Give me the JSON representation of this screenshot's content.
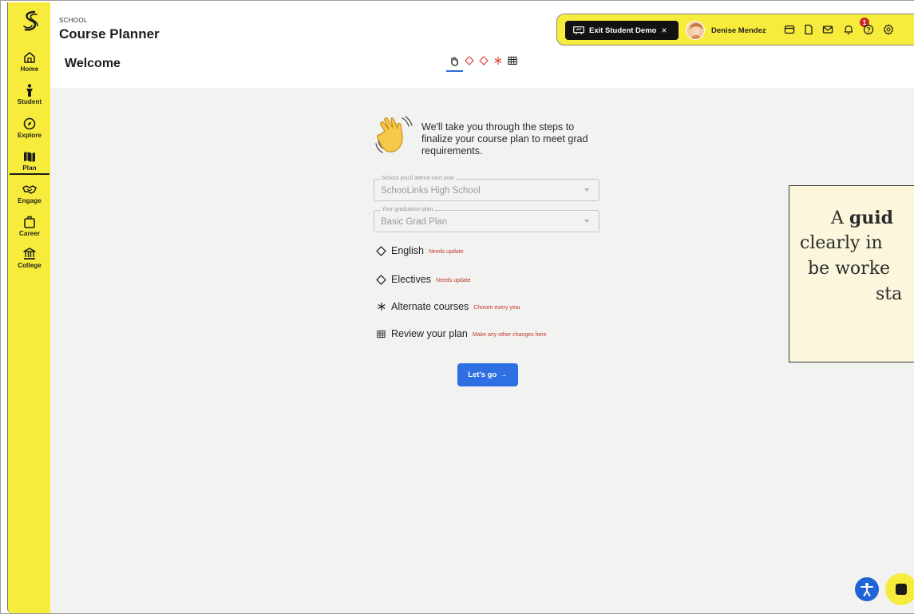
{
  "app": {
    "school_caption": "SCHOOL",
    "title": "Course Planner"
  },
  "page": {
    "title": "Welcome"
  },
  "sidebar": {
    "items": [
      {
        "label": "Home",
        "icon": "home-icon"
      },
      {
        "label": "Student",
        "icon": "student-icon"
      },
      {
        "label": "Explore",
        "icon": "compass-icon"
      },
      {
        "label": "Plan",
        "icon": "map-icon",
        "active": true
      },
      {
        "label": "Engage",
        "icon": "handshake-icon"
      },
      {
        "label": "Career",
        "icon": "briefcase-icon"
      },
      {
        "label": "College",
        "icon": "college-icon"
      }
    ]
  },
  "toolbar": {
    "exit_demo_label": "Exit Student Demo",
    "exit_demo_close": "×",
    "user_name": "Denise Mendez",
    "notification_count": "1",
    "icons": [
      "wallet-icon",
      "document-icon",
      "mail-icon",
      "bell-icon",
      "help-icon",
      "settings-icon"
    ]
  },
  "step_tabs": [
    "wave-icon",
    "diamond-icon",
    "diamond-icon",
    "asterisk-icon",
    "grid-icon"
  ],
  "intro": {
    "text": "We'll take you through the steps to finalize your course plan to meet grad requirements."
  },
  "form": {
    "school_legend": "School you'll attend next year",
    "school_value": "SchooLinks High School",
    "plan_legend": "Your graduation plan",
    "plan_value": "Basic Grad Plan"
  },
  "steps": [
    {
      "icon": "diamond-icon",
      "label": "English",
      "note": "Needs update"
    },
    {
      "icon": "diamond-icon",
      "label": "Electives",
      "note": "Needs update"
    },
    {
      "icon": "asterisk-icon",
      "label": "Alternate courses",
      "note": "Chosen every year"
    },
    {
      "icon": "grid-icon",
      "label": "Review your plan",
      "note": "Make any other changes here"
    }
  ],
  "go_button": {
    "label": "Let's go",
    "arrow": "→"
  },
  "callout": {
    "line1_prefix": "A ",
    "line1_bold": "guid",
    "line2": "clearly in",
    "line3": "be worke",
    "line4": "sta"
  },
  "colors": {
    "accent_yellow": "#f7ec3c",
    "primary_blue": "#2f6fe4",
    "needs_update_red": "#c0392b",
    "background": "#f2f2f1"
  }
}
